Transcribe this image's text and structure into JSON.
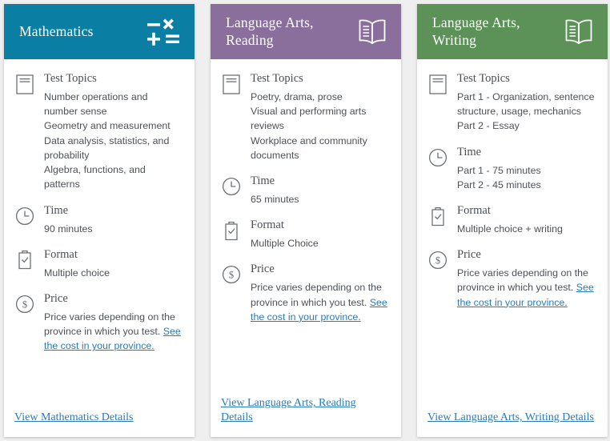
{
  "colors": {
    "math_header": "#0b7ea3",
    "reading_header": "#8a6e9c",
    "writing_header": "#5c9158",
    "link": "#2a7ab8",
    "body_text": "#4d5258",
    "heading_text": "#4a4f55",
    "page_background": "#efefef",
    "card_background": "#ffffff"
  },
  "cards": [
    {
      "id": "mathematics",
      "title": "Mathematics",
      "header_icon": "math-operators-icon",
      "sections": [
        {
          "icon": "document-icon",
          "title": "Test Topics",
          "lines": [
            "Number operations and number sense",
            "Geometry and measurement",
            "Data analysis, statistics, and probability",
            "Algebra, functions, and patterns"
          ]
        },
        {
          "icon": "clock-icon",
          "title": "Time",
          "lines": [
            "90 minutes"
          ]
        },
        {
          "icon": "clipboard-check-icon",
          "title": "Format",
          "lines": [
            "Multiple choice"
          ]
        },
        {
          "icon": "dollar-circle-icon",
          "title": "Price",
          "price_text": "Price varies depending on the province in which you test. ",
          "price_link": "See the cost in your province."
        }
      ],
      "footer_link": "View Mathematics Details"
    },
    {
      "id": "language-arts-reading",
      "title": "Language Arts, Reading",
      "header_icon": "open-book-icon",
      "sections": [
        {
          "icon": "document-icon",
          "title": "Test Topics",
          "lines": [
            "Poetry, drama, prose",
            "Visual and performing arts reviews",
            "Workplace and community documents"
          ]
        },
        {
          "icon": "clock-icon",
          "title": "Time",
          "lines": [
            "65 minutes"
          ]
        },
        {
          "icon": "clipboard-check-icon",
          "title": "Format",
          "lines": [
            "Multiple Choice"
          ]
        },
        {
          "icon": "dollar-circle-icon",
          "title": "Price",
          "price_text": "Price varies depending on the province in which you test. ",
          "price_link": "See the cost in your province."
        }
      ],
      "footer_link": "View Language Arts, Reading Details"
    },
    {
      "id": "language-arts-writing",
      "title": "Language Arts, Writing",
      "header_icon": "open-book-icon",
      "sections": [
        {
          "icon": "document-icon",
          "title": "Test Topics",
          "lines": [
            "Part 1 - Organization, sentence structure, usage, mechanics",
            "Part 2 - Essay"
          ]
        },
        {
          "icon": "clock-icon",
          "title": "Time",
          "lines": [
            "Part 1 - 75 minutes",
            "Part 2 - 45 minutes"
          ]
        },
        {
          "icon": "clipboard-check-icon",
          "title": "Format",
          "lines": [
            "Multiple choice + writing"
          ]
        },
        {
          "icon": "dollar-circle-icon",
          "title": "Price",
          "price_text": "Price varies depending on the province in which you test. ",
          "price_link": "See the cost in your province."
        }
      ],
      "footer_link": "View Language Arts, Writing Details"
    }
  ]
}
